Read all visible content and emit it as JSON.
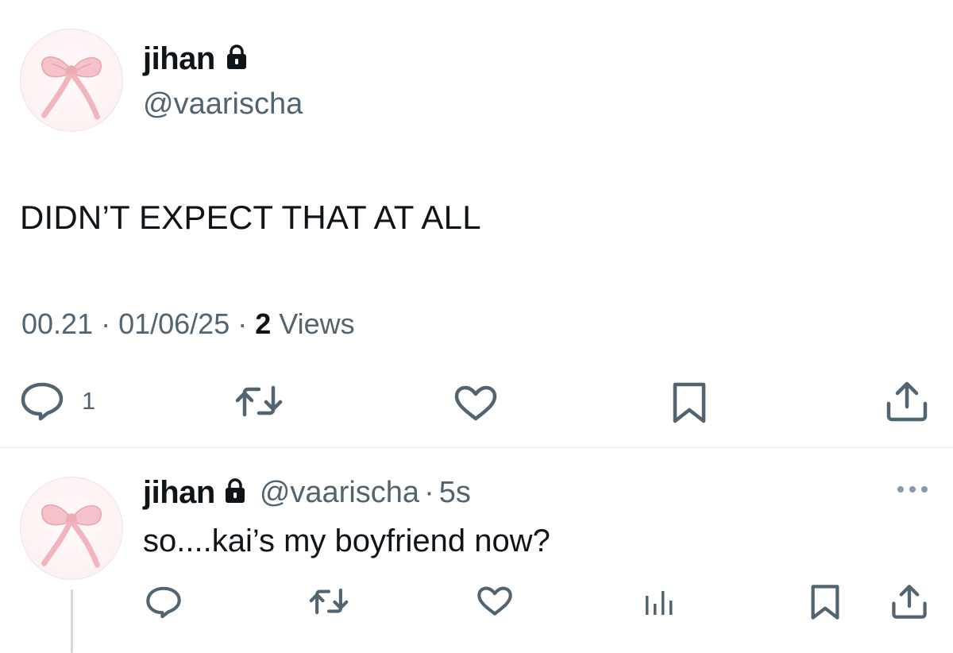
{
  "main_tweet": {
    "display_name": "jihan",
    "handle": "@vaarischa",
    "text": "DIDN’T EXPECT THAT AT ALL",
    "time": "00.21",
    "date": "01/06/25",
    "views_count": "2",
    "views_label": "Views",
    "separator": "·",
    "actions": {
      "reply_count": "1"
    }
  },
  "reply_tweet": {
    "display_name": "jihan",
    "handle": "@vaarischa",
    "separator": "·",
    "time_ago": "5s",
    "text": "so....kai’s my boyfriend now?"
  },
  "icons": {
    "lock": "lock-icon",
    "reply": "speech-bubble-icon",
    "retweet": "retweet-arrows-icon",
    "like": "heart-icon",
    "bookmark": "bookmark-icon",
    "share": "share-upload-icon",
    "views": "bar-chart-icon",
    "more": "three-dots-icon"
  },
  "colors": {
    "text": "#0f1419",
    "secondary": "#536471",
    "divider": "#e1e6ea",
    "avatar_bow": "#f2b3bb"
  }
}
